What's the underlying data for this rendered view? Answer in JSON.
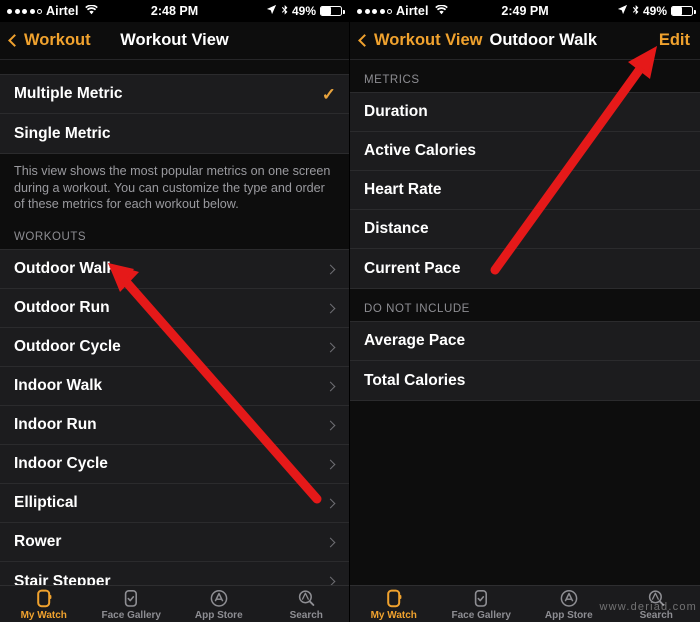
{
  "status_bar": {
    "carrier": "Airtel",
    "signal_dots_filled": 4,
    "signal_dots_total": 5,
    "wifi_icon": "wifi-icon",
    "time_left": "2:48 PM",
    "time_right": "2:49 PM",
    "location_icon": "location-arrow-icon",
    "bluetooth_icon": "bluetooth-icon",
    "battery_percent": "49%",
    "battery_level": 49
  },
  "left_screen": {
    "nav": {
      "back_label": "Workout",
      "title": "Workout View"
    },
    "view_options": [
      {
        "label": "Multiple Metric",
        "selected": true,
        "check_glyph": "✓"
      },
      {
        "label": "Single Metric",
        "selected": false
      }
    ],
    "footer_note": "This view shows the most popular metrics on one screen during a workout. You can customize the type and order of these metrics for each workout below.",
    "section_header": "WORKOUTS",
    "workouts": [
      "Outdoor Walk",
      "Outdoor Run",
      "Outdoor Cycle",
      "Indoor Walk",
      "Indoor Run",
      "Indoor Cycle",
      "Elliptical",
      "Rower",
      "Stair Stepper"
    ]
  },
  "right_screen": {
    "nav": {
      "back_label": "Workout View",
      "title": "Outdoor Walk",
      "action_label": "Edit"
    },
    "metrics_header": "METRICS",
    "metrics": [
      "Duration",
      "Active Calories",
      "Heart Rate",
      "Distance",
      "Current Pace"
    ],
    "excluded_header": "DO NOT INCLUDE",
    "excluded": [
      "Average Pace",
      "Total Calories"
    ]
  },
  "tabbar": {
    "items": [
      {
        "label": "My Watch",
        "icon": "apple-watch-icon",
        "active": true
      },
      {
        "label": "Face Gallery",
        "icon": "watch-face-icon",
        "active": false
      },
      {
        "label": "App Store",
        "icon": "app-store-icon",
        "active": false
      },
      {
        "label": "Search",
        "icon": "search-icon",
        "active": false
      }
    ]
  },
  "annotations": {
    "arrow_color": "#e51919",
    "left_arrow_target": "Outdoor Walk",
    "right_arrow_target": "Edit",
    "watermark": "www.deriad.com"
  },
  "colors": {
    "accent": "#f0a22e",
    "row_bg": "#1c1c1e",
    "page_bg": "#0d0d0d",
    "separator": "#2b2b2d",
    "secondary_text": "#8d8d92"
  }
}
